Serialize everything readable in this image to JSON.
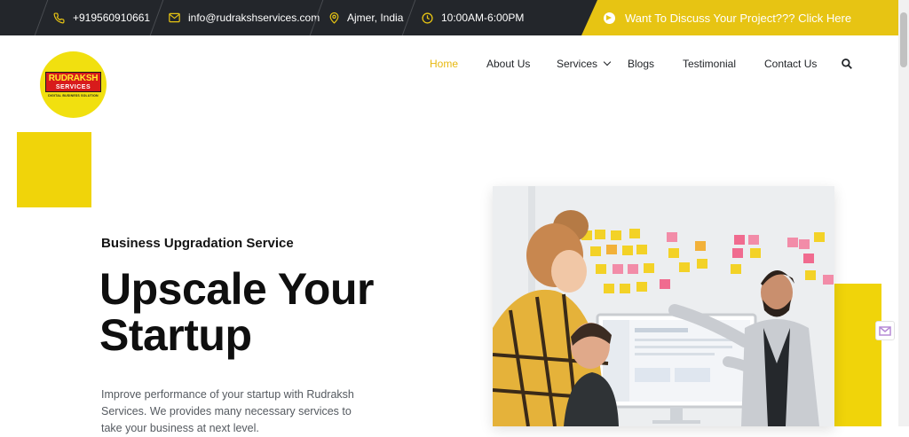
{
  "topbar": {
    "phone": "+919560910661",
    "email": "info@rudrakshservices.com",
    "location": "Ajmer, India",
    "hours": "10:00AM-6:00PM",
    "cta": "Want To Discuss Your Project??? Click Here"
  },
  "logo": {
    "line1": "RUDRAKSH",
    "line2": "SERVICES",
    "tagline": "DIGITAL BUSINESS SOLUTION"
  },
  "nav": {
    "home": "Home",
    "about": "About Us",
    "services": "Services",
    "blogs": "Blogs",
    "testimonial": "Testimonial",
    "contact": "Contact Us"
  },
  "hero": {
    "subtitle": "Business Upgradation Service",
    "headline_line1": "Upscale Your",
    "headline_line2": "Startup",
    "description": "Improve performance of your startup with Rudraksh Services. We provides many necessary services to take your business at next level."
  },
  "colors": {
    "accent": "#e7c413",
    "dark": "#23262b",
    "nav_active": "#e7b80f"
  },
  "icons": {
    "phone": "phone-icon",
    "email": "envelope-icon",
    "location": "map-pin-icon",
    "hours": "clock-icon",
    "cta": "arrow-circle-icon",
    "search": "search-icon",
    "services_dropdown": "chevron-down-icon"
  }
}
